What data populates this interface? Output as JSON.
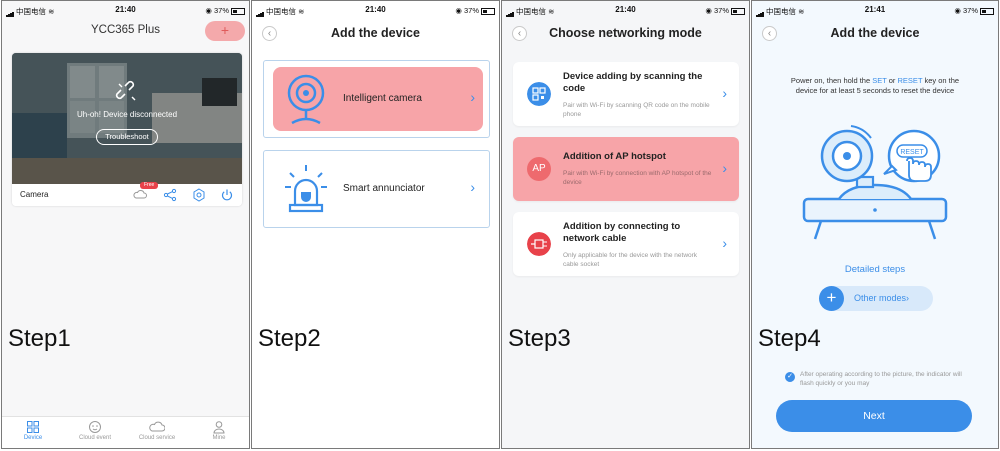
{
  "status": {
    "carrier": "中国电信",
    "battery": "37%",
    "times": [
      "21:40",
      "21:40",
      "21:40",
      "21:41"
    ]
  },
  "colors": {
    "accent": "#3b8ee8",
    "highlight": "#f7a4a8",
    "danger": "#e8424a"
  },
  "step1": {
    "app_title": "YCC365 Plus",
    "add_label": "+",
    "camera_message": "Uh-oh! Device disconnected",
    "troubleshoot_label": "Troubleshoot",
    "camera_name": "Camera",
    "free_badge": "Free",
    "footer_icons": [
      "cloud-icon",
      "share-icon",
      "settings-icon",
      "power-icon"
    ],
    "tabs": [
      {
        "label": "Device",
        "icon": "device-icon",
        "active": true
      },
      {
        "label": "Cloud event",
        "icon": "cloud-event-icon",
        "active": false
      },
      {
        "label": "Cloud service",
        "icon": "cloud-service-icon",
        "active": false
      },
      {
        "label": "Mine",
        "icon": "user-icon",
        "active": false
      }
    ],
    "step_label": "Step1"
  },
  "step2": {
    "title": "Add the device",
    "devices": [
      {
        "label": "Intelligent camera",
        "icon": "camera-icon",
        "highlighted": true
      },
      {
        "label": "Smart annunciator",
        "icon": "alarm-light-icon",
        "highlighted": false
      }
    ],
    "step_label": "Step2"
  },
  "step3": {
    "title": "Choose networking mode",
    "modes": [
      {
        "title": "Device adding by scanning the code",
        "desc": "Pair with Wi-Fi by scanning QR code on the mobile phone",
        "icon": "qr-code-icon",
        "highlighted": false
      },
      {
        "title": "Addition of AP hotspot",
        "desc": "Pair with Wi-Fi by connection with AP hotspot of the device",
        "icon": "ap-icon",
        "icon_text": "AP",
        "highlighted": true
      },
      {
        "title": "Addition by connecting to network cable",
        "desc": "Only applicable for the device with the network cable socket",
        "icon": "network-cable-icon",
        "highlighted": false
      }
    ],
    "step_label": "Step3"
  },
  "step4": {
    "title": "Add the device",
    "instruction_pre": "Power on, then hold the ",
    "key_set": "SET",
    "instruction_or": " or ",
    "key_reset": "RESET",
    "instruction_post": " key on the device for at least 5 seconds to reset the device",
    "bubble_label": "RESET",
    "detailed_steps": "Detailed steps",
    "other_modes": "Other modes",
    "agree_text": "After operating according to the picture, the indicator will flash quickly or you may",
    "next_label": "Next",
    "step_label": "Step4"
  }
}
